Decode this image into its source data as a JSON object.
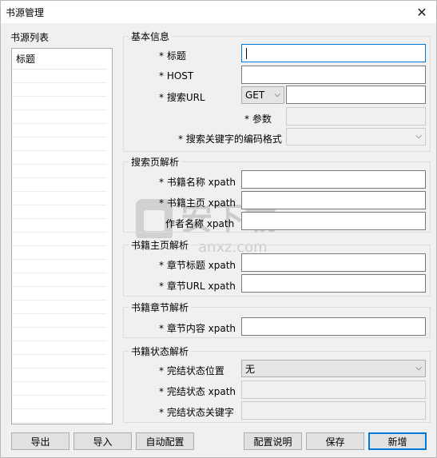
{
  "window": {
    "title": "书源管理",
    "close_glyph": "✕"
  },
  "book_list": {
    "title": "书源列表",
    "header": "标题"
  },
  "basic": {
    "title": "基本信息",
    "title_label": "* 标题",
    "host_label": "* HOST",
    "search_url_label": "* 搜索URL",
    "method_value": "GET",
    "params_label": "* 参数",
    "encoding_label": "* 搜索关键字的编码格式"
  },
  "search_page": {
    "title": "搜索页解析",
    "book_name_label": "* 书籍名称 xpath",
    "book_home_label": "* 书籍主页 xpath",
    "author_label": "作者名称 xpath"
  },
  "book_home": {
    "title": "书籍主页解析",
    "chapter_title_label": "* 章节标题 xpath",
    "chapter_url_label": "* 章节URL  xpath"
  },
  "book_chapter": {
    "title": "书籍章节解析",
    "chapter_content_label": "* 章节内容 xpath"
  },
  "book_status": {
    "title": "书籍状态解析",
    "status_pos_label": "* 完结状态位置",
    "status_pos_value": "无",
    "status_xpath_label": "* 完结状态 xpath",
    "status_keyword_label": "* 完结状态关键字"
  },
  "buttons": {
    "export": "导出",
    "import": "导入",
    "auto_config": "自动配置",
    "config_help": "配置说明",
    "save": "保存",
    "add": "新增"
  },
  "watermark": {
    "text": "安下载",
    "sub": "anxz.com"
  },
  "colors": {
    "focus": "#0078d7",
    "border": "#7a7a7a"
  }
}
